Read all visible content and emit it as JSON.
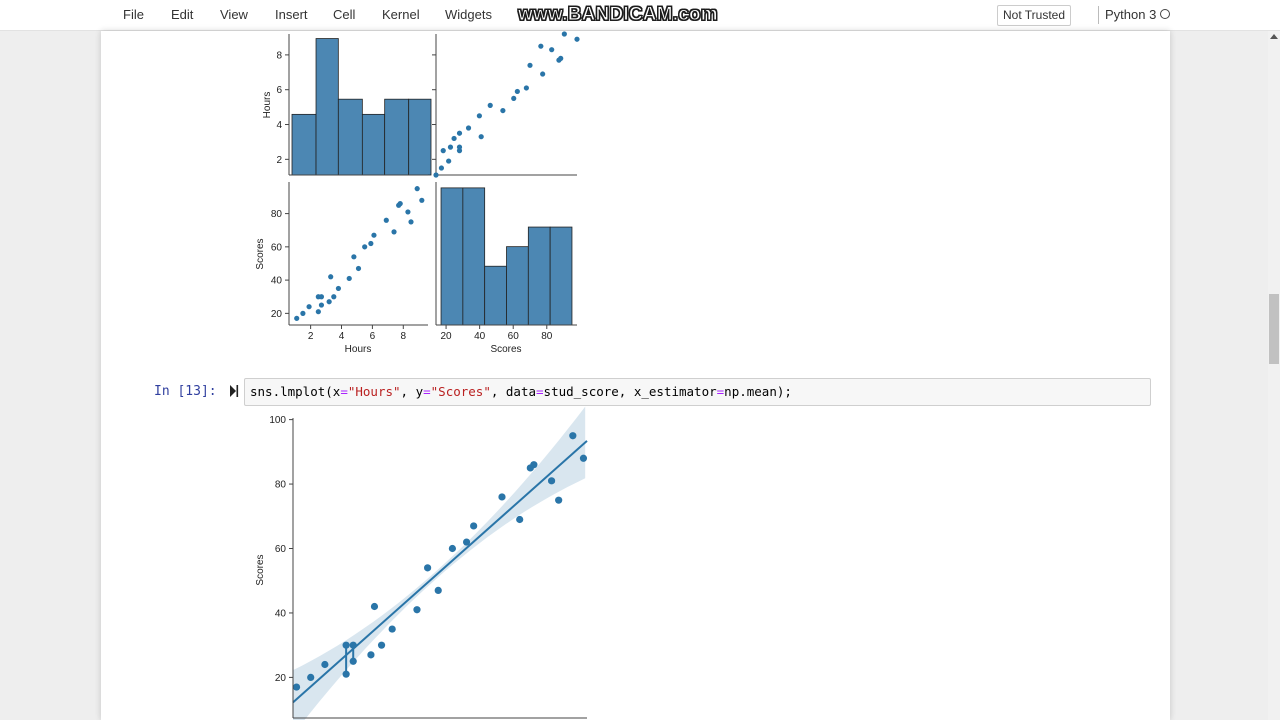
{
  "menubar": {
    "items": [
      "File",
      "Edit",
      "View",
      "Insert",
      "Cell",
      "Kernel",
      "Widgets"
    ],
    "watermark": "www.BANDICAM.com",
    "trusted_label": "Not Trusted",
    "kernel_label": "Python 3"
  },
  "cell": {
    "prompt": "In [13]:",
    "code": {
      "p1": "sns.lmplot(x",
      "eq1": "=",
      "s1": "\"Hours\"",
      "p2": ", y",
      "eq2": "=",
      "s2": "\"Scores\"",
      "p3": ", data",
      "eq3": "=",
      "p4": "stud_score, x_estimator",
      "eq4": "=",
      "p5": "np.mean);"
    }
  },
  "colors": {
    "accent": "#2a75a8",
    "hist_fill": "#4c87b3",
    "prompt": "#303f9f",
    "string": "#ba2121",
    "operator": "#aa22ff"
  },
  "chart_data": [
    {
      "type": "histogram",
      "panel": "pairplot Hours vs Hours",
      "ylabel": "Hours",
      "bin_edges": [
        1.1,
        2.5,
        3.8,
        5.2,
        6.5,
        7.9,
        9.2
      ],
      "counts": [
        4,
        9,
        5,
        4,
        5,
        5
      ],
      "yticks": [
        2,
        4,
        6,
        8
      ],
      "ylim": [
        1.1,
        9.2
      ]
    },
    {
      "type": "scatter",
      "panel": "pairplot Hours vs Scores",
      "xlim": [
        17,
        95
      ],
      "ylim": [
        1.1,
        9.2
      ]
    },
    {
      "type": "scatter",
      "panel": "pairplot Scores vs Hours",
      "xlabel": "Hours",
      "ylabel": "Scores",
      "xticks": [
        2,
        4,
        6,
        8
      ],
      "yticks": [
        20,
        40,
        60,
        80
      ],
      "xlim": [
        0.6,
        9.6
      ],
      "ylim": [
        13,
        99
      ]
    },
    {
      "type": "histogram",
      "panel": "pairplot Scores vs Scores",
      "xlabel": "Scores",
      "xticks": [
        20,
        40,
        60,
        80
      ],
      "bin_edges": [
        17,
        30,
        43,
        56,
        69,
        82,
        95
      ],
      "counts": [
        7,
        7,
        3,
        4,
        5,
        5
      ],
      "xlim": [
        14,
        98
      ]
    },
    {
      "type": "scatter",
      "panel": "lmplot",
      "ylabel": "Scores",
      "yticks": [
        20,
        40,
        60,
        80,
        100
      ],
      "xlim": [
        1.0,
        9.3
      ],
      "ylim": [
        7.4,
        100.5
      ],
      "regression": {
        "slope": 9.776,
        "intercept": 2.48
      },
      "estimator_points": [
        {
          "x": 2.5,
          "y": 25.5,
          "err": [
            21,
            30
          ]
        },
        {
          "x": 2.7,
          "y": 27.5,
          "err": [
            25,
            30
          ]
        }
      ]
    }
  ],
  "shared_points": {
    "hours": [
      1.1,
      1.5,
      1.9,
      2.5,
      2.5,
      2.7,
      2.7,
      3.2,
      3.3,
      3.5,
      3.8,
      4.5,
      4.8,
      5.1,
      5.5,
      5.9,
      6.1,
      6.9,
      7.4,
      7.7,
      7.8,
      8.3,
      8.5,
      8.9,
      9.2
    ],
    "scores": [
      17,
      20,
      24,
      21,
      30,
      25,
      30,
      27,
      42,
      30,
      35,
      41,
      54,
      47,
      60,
      62,
      67,
      76,
      69,
      85,
      86,
      81,
      75,
      95,
      88
    ]
  }
}
